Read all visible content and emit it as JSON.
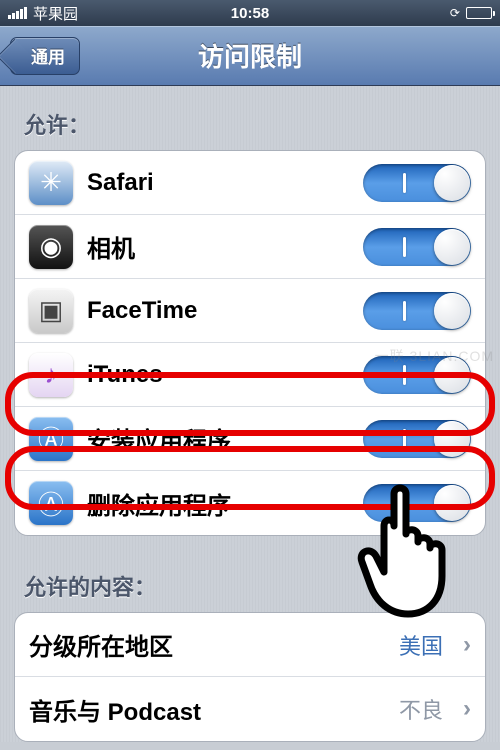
{
  "status": {
    "carrier": "苹果园",
    "time": "10:58"
  },
  "nav": {
    "back_label": "通用",
    "title": "访问限制"
  },
  "sections": {
    "allow_header": "允许：",
    "allowed_content_header": "允许的内容："
  },
  "allow_items": [
    {
      "label": "Safari",
      "icon_name": "safari-icon"
    },
    {
      "label": "相机",
      "icon_name": "camera-icon"
    },
    {
      "label": "FaceTime",
      "icon_name": "facetime-icon"
    },
    {
      "label": "iTunes",
      "icon_name": "itunes-icon"
    },
    {
      "label": "安装应用程序",
      "icon_name": "appstore-icon"
    },
    {
      "label": "删除应用程序",
      "icon_name": "appstore-icon"
    }
  ],
  "content_items": [
    {
      "label": "分级所在地区",
      "value": "美国",
      "value_color": "#3b6fb5"
    },
    {
      "label": "音乐与 Podcast",
      "value": "不良",
      "value_color": "#8f98a6"
    }
  ],
  "watermark": "一联 3LIAN.COM"
}
